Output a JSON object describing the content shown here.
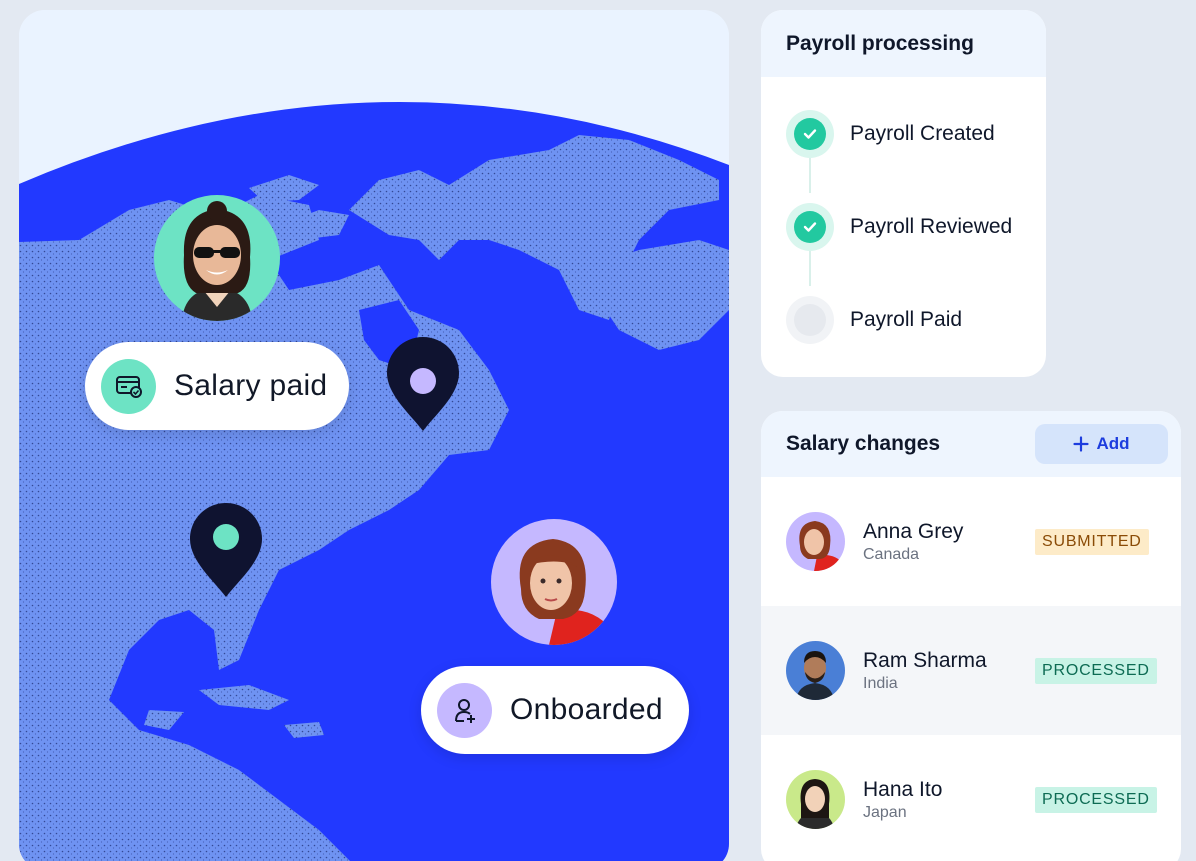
{
  "map_card": {
    "salary_pill_label": "Salary paid",
    "onboarded_pill_label": "Onboarded"
  },
  "payroll": {
    "title": "Payroll processing",
    "steps": [
      {
        "label": "Payroll Created",
        "status": "done"
      },
      {
        "label": "Payroll Reviewed",
        "status": "done"
      },
      {
        "label": "Payroll Paid",
        "status": "pending"
      }
    ]
  },
  "salary_changes": {
    "title": "Salary changes",
    "add_label": "Add",
    "rows": [
      {
        "name": "Anna Grey",
        "country": "Canada",
        "status": "SUBMITTED"
      },
      {
        "name": "Ram Sharma",
        "country": "India",
        "status": "PROCESSED"
      },
      {
        "name": "Hana Ito",
        "country": "Japan",
        "status": "PROCESSED"
      }
    ]
  },
  "colors": {
    "ocean": "#2239ff",
    "land": "#6f93f2",
    "accent_green": "#22c9a0",
    "pin_dark": "#0f1330",
    "submitted_bg": "#fdebc8",
    "processed_bg": "#c8f3e6"
  }
}
